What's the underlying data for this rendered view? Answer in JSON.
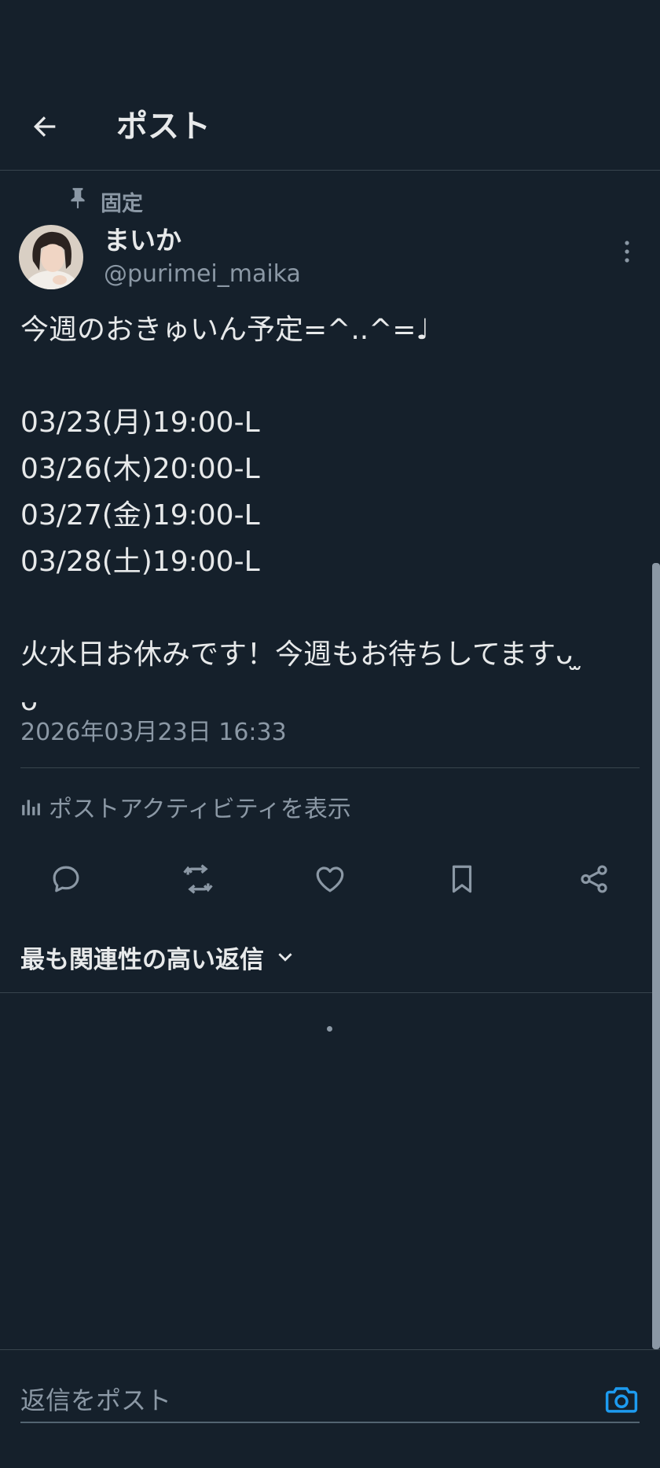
{
  "header": {
    "title": "ポスト",
    "back_icon": "arrow-left-icon"
  },
  "post": {
    "pinned_label": "固定",
    "author": {
      "display_name": "まいか",
      "handle": "@purimei_maika"
    },
    "body": {
      "intro": "今週のおきゅいん予定=^..^=♩",
      "schedule": [
        "03/23(月)19:00-L",
        "03/26(木)20:00-L",
        "03/27(金)19:00-L",
        "03/28(土)19:00-L"
      ],
      "closing": "火水日お休みです！今週もお待ちしてます",
      "closing_emoticon_a": "ᴗ ̫",
      "closing_emoticon_b": "ᴗ"
    },
    "timestamp": "2026年03月23日 16:33",
    "activity_label": "ポストアクティビティを表示"
  },
  "actions": [
    {
      "name": "reply",
      "icon": "reply-icon"
    },
    {
      "name": "repost",
      "icon": "repost-icon"
    },
    {
      "name": "like",
      "icon": "heart-icon"
    },
    {
      "name": "bookmark",
      "icon": "bookmark-icon"
    },
    {
      "name": "share",
      "icon": "share-icon"
    }
  ],
  "replies": {
    "sort_label": "最も関連性の高い返信"
  },
  "composer": {
    "placeholder": "返信をポスト",
    "camera_icon": "camera-icon"
  },
  "colors": {
    "background": "#15202b",
    "text_primary": "#e7e9ea",
    "text_secondary": "#8b98a5",
    "divider": "#38444d",
    "accent": "#1d9bf0"
  }
}
